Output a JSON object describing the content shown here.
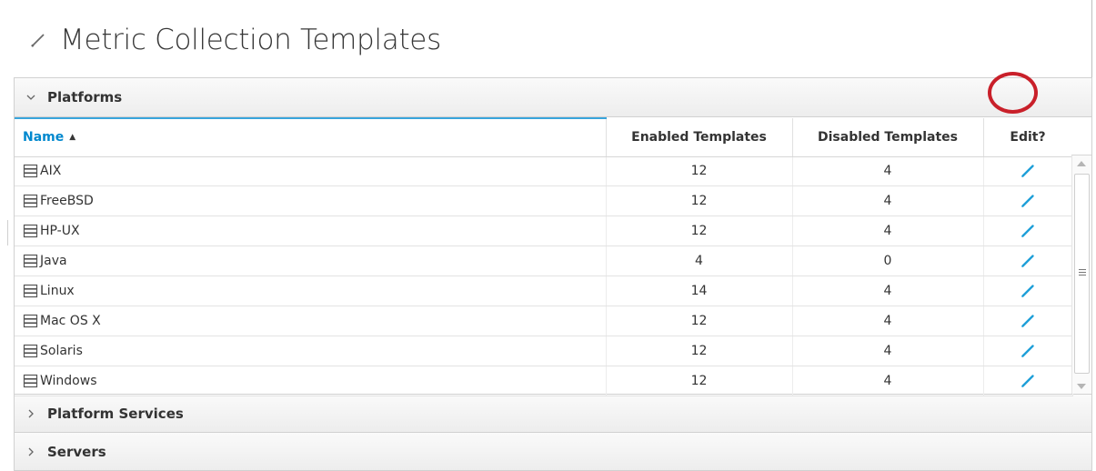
{
  "page": {
    "title": "Metric Collection Templates",
    "title_icon": "pencil-icon"
  },
  "sections": {
    "platforms": {
      "label": "Platforms",
      "expanded": true
    },
    "platform_services": {
      "label": "Platform Services",
      "expanded": false
    },
    "servers": {
      "label": "Servers",
      "expanded": false
    }
  },
  "table": {
    "columns": {
      "name": "Name",
      "enabled": "Enabled Templates",
      "disabled": "Disabled Templates",
      "edit": "Edit?"
    },
    "sort": {
      "column": "Name",
      "direction": "ascending",
      "icon": "sort-ascending-icon"
    },
    "row_icon": "server-icon",
    "edit_icon": "pencil-icon",
    "rows": [
      {
        "name": "AIX",
        "enabled": "12",
        "disabled": "4"
      },
      {
        "name": "FreeBSD",
        "enabled": "12",
        "disabled": "4"
      },
      {
        "name": "HP-UX",
        "enabled": "12",
        "disabled": "4"
      },
      {
        "name": "Java",
        "enabled": "4",
        "disabled": "0"
      },
      {
        "name": "Linux",
        "enabled": "14",
        "disabled": "4"
      },
      {
        "name": "Mac OS X",
        "enabled": "12",
        "disabled": "4"
      },
      {
        "name": "Solaris",
        "enabled": "12",
        "disabled": "4"
      },
      {
        "name": "Windows",
        "enabled": "12",
        "disabled": "4"
      }
    ]
  },
  "colors": {
    "accent_blue": "#0088ce",
    "pencil_blue": "#1e9fd8",
    "highlight_red": "#c9202a",
    "header_text": "#333333"
  }
}
